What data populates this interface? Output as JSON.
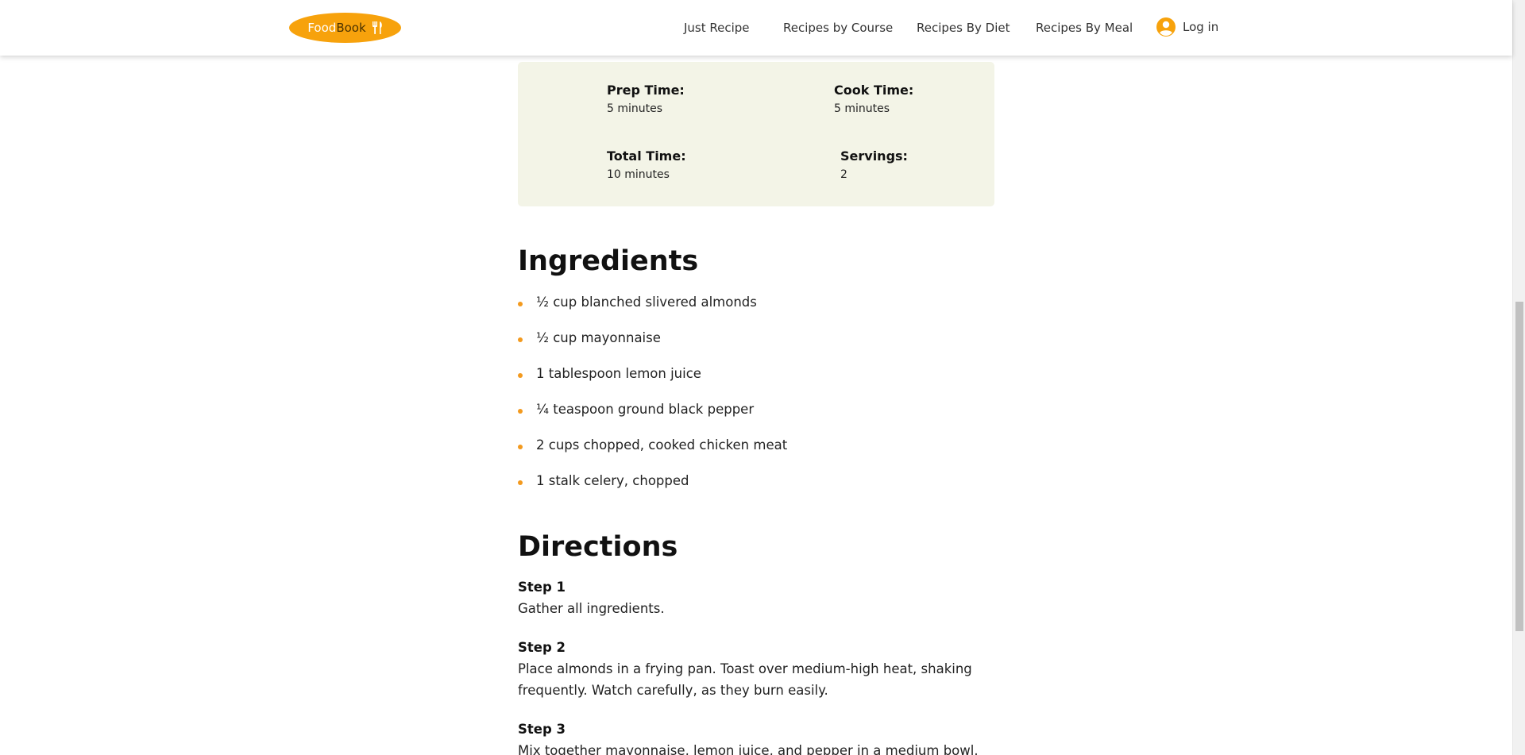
{
  "header": {
    "logo_part1": "Food",
    "logo_part2": "Book",
    "logo_icon": "utensils-icon",
    "nav": [
      {
        "label": "Just Recipe"
      },
      {
        "label": "Recipes by Course"
      },
      {
        "label": "Recipes By Diet"
      },
      {
        "label": "Recipes By Meal"
      }
    ],
    "login_label": "Log in",
    "login_icon": "user-circle-icon"
  },
  "info": {
    "prep_time_label": "Prep Time:",
    "prep_time_value": "5 minutes",
    "cook_time_label": "Cook Time:",
    "cook_time_value": "5 minutes",
    "total_time_label": "Total Time:",
    "total_time_value": "10 minutes",
    "servings_label": "Servings:",
    "servings_value": "2"
  },
  "ingredients": {
    "title": "Ingredients",
    "items": [
      "½ cup blanched slivered almonds",
      "½ cup mayonnaise",
      "1 tablespoon lemon juice",
      "¼ teaspoon ground black pepper",
      "2 cups chopped, cooked chicken meat",
      "1 stalk celery, chopped"
    ]
  },
  "directions": {
    "title": "Directions",
    "steps": [
      {
        "title": "Step 1",
        "text": "Gather all ingredients."
      },
      {
        "title": "Step 2",
        "text": "Place almonds in a frying pan. Toast over medium-high heat, shaking frequently. Watch carefully, as they burn easily."
      },
      {
        "title": "Step 3",
        "text": "Mix together mayonnaise, lemon juice, and pepper in a medium bowl."
      }
    ]
  },
  "colors": {
    "brand": "#f7a20c",
    "info_bg": "#f3f4e7",
    "bullet": "#f39a1e"
  }
}
